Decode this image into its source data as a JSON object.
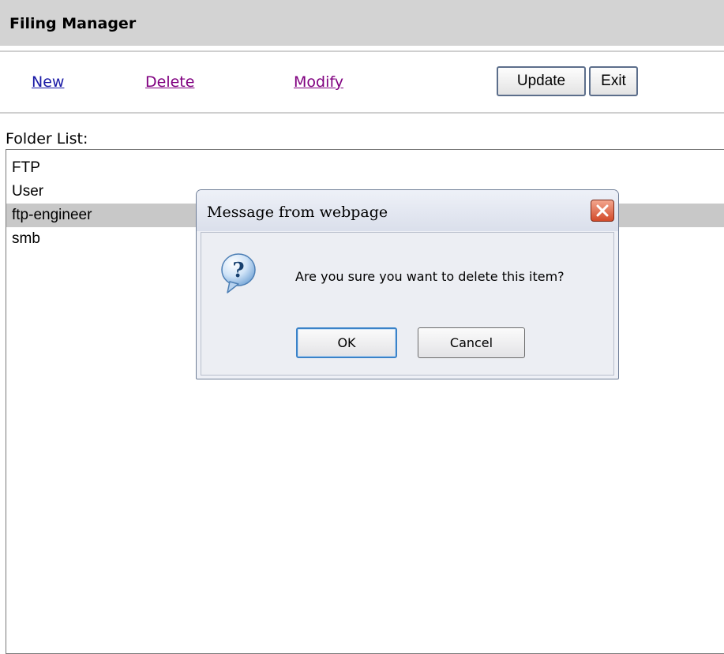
{
  "app": {
    "title": "Filing Manager"
  },
  "toolbar": {
    "new_label": "New",
    "delete_label": "Delete",
    "modify_label": "Modify",
    "update_label": "Update",
    "exit_label": "Exit"
  },
  "folders": {
    "label": "Folder List:",
    "items": [
      "FTP",
      "User",
      "ftp-engineer",
      "smb"
    ],
    "selected": "ftp-engineer"
  },
  "dialog": {
    "title": "Message from webpage",
    "message": "Are you sure you want to delete this item?",
    "ok_label": "OK",
    "cancel_label": "Cancel",
    "icon": "question-icon"
  },
  "colors": {
    "header_bg": "#d3d3d3",
    "link_unvisited": "#1a1aa6",
    "link_visited": "#800080",
    "selection_bg": "#c8c8c8",
    "close_button": "#d24a2a"
  }
}
